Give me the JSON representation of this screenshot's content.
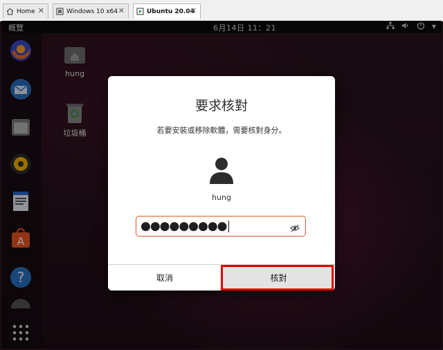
{
  "host_tabs": [
    {
      "label": "Home",
      "icon": "home-icon"
    },
    {
      "label": "Windows 10 x64",
      "icon": "vm-icon"
    },
    {
      "label": "Ubuntu 20.04",
      "icon": "vm-running-icon",
      "active": true
    }
  ],
  "topbar": {
    "activities": "概覽",
    "clock": "6月14日  11：21"
  },
  "desktop": {
    "icons": [
      {
        "label": "hung",
        "icon": "home-folder-icon"
      },
      {
        "label": "垃圾桶",
        "icon": "trash-icon"
      }
    ]
  },
  "dialog": {
    "title": "要求核對",
    "description": "若要安裝或移除軟體，需要核對身分。",
    "username": "hung",
    "password_mask": "●●●●●●●●●",
    "cancel_label": "取消",
    "authenticate_label": "核對"
  },
  "colors": {
    "accent": "#e95420",
    "highlight": "#e60000"
  }
}
